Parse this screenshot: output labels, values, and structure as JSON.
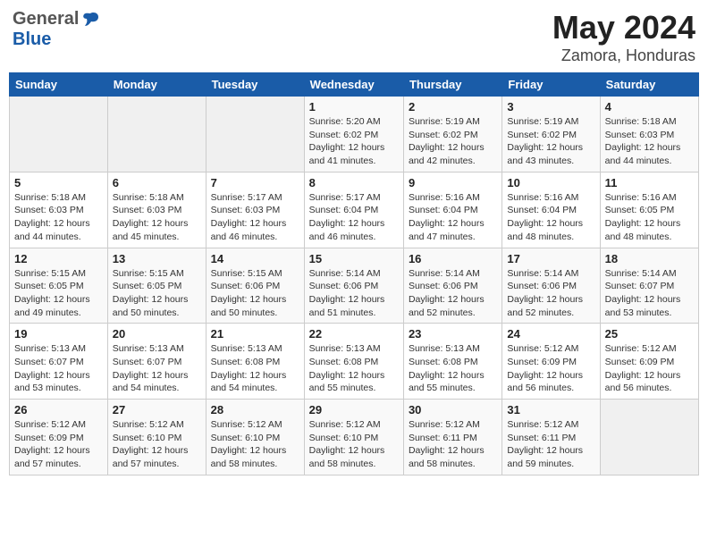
{
  "header": {
    "logo_general": "General",
    "logo_blue": "Blue",
    "month": "May 2024",
    "location": "Zamora, Honduras"
  },
  "days_of_week": [
    "Sunday",
    "Monday",
    "Tuesday",
    "Wednesday",
    "Thursday",
    "Friday",
    "Saturday"
  ],
  "weeks": [
    [
      {
        "day": "",
        "info": ""
      },
      {
        "day": "",
        "info": ""
      },
      {
        "day": "",
        "info": ""
      },
      {
        "day": "1",
        "info": "Sunrise: 5:20 AM\nSunset: 6:02 PM\nDaylight: 12 hours\nand 41 minutes."
      },
      {
        "day": "2",
        "info": "Sunrise: 5:19 AM\nSunset: 6:02 PM\nDaylight: 12 hours\nand 42 minutes."
      },
      {
        "day": "3",
        "info": "Sunrise: 5:19 AM\nSunset: 6:02 PM\nDaylight: 12 hours\nand 43 minutes."
      },
      {
        "day": "4",
        "info": "Sunrise: 5:18 AM\nSunset: 6:03 PM\nDaylight: 12 hours\nand 44 minutes."
      }
    ],
    [
      {
        "day": "5",
        "info": "Sunrise: 5:18 AM\nSunset: 6:03 PM\nDaylight: 12 hours\nand 44 minutes."
      },
      {
        "day": "6",
        "info": "Sunrise: 5:18 AM\nSunset: 6:03 PM\nDaylight: 12 hours\nand 45 minutes."
      },
      {
        "day": "7",
        "info": "Sunrise: 5:17 AM\nSunset: 6:03 PM\nDaylight: 12 hours\nand 46 minutes."
      },
      {
        "day": "8",
        "info": "Sunrise: 5:17 AM\nSunset: 6:04 PM\nDaylight: 12 hours\nand 46 minutes."
      },
      {
        "day": "9",
        "info": "Sunrise: 5:16 AM\nSunset: 6:04 PM\nDaylight: 12 hours\nand 47 minutes."
      },
      {
        "day": "10",
        "info": "Sunrise: 5:16 AM\nSunset: 6:04 PM\nDaylight: 12 hours\nand 48 minutes."
      },
      {
        "day": "11",
        "info": "Sunrise: 5:16 AM\nSunset: 6:05 PM\nDaylight: 12 hours\nand 48 minutes."
      }
    ],
    [
      {
        "day": "12",
        "info": "Sunrise: 5:15 AM\nSunset: 6:05 PM\nDaylight: 12 hours\nand 49 minutes."
      },
      {
        "day": "13",
        "info": "Sunrise: 5:15 AM\nSunset: 6:05 PM\nDaylight: 12 hours\nand 50 minutes."
      },
      {
        "day": "14",
        "info": "Sunrise: 5:15 AM\nSunset: 6:06 PM\nDaylight: 12 hours\nand 50 minutes."
      },
      {
        "day": "15",
        "info": "Sunrise: 5:14 AM\nSunset: 6:06 PM\nDaylight: 12 hours\nand 51 minutes."
      },
      {
        "day": "16",
        "info": "Sunrise: 5:14 AM\nSunset: 6:06 PM\nDaylight: 12 hours\nand 52 minutes."
      },
      {
        "day": "17",
        "info": "Sunrise: 5:14 AM\nSunset: 6:06 PM\nDaylight: 12 hours\nand 52 minutes."
      },
      {
        "day": "18",
        "info": "Sunrise: 5:14 AM\nSunset: 6:07 PM\nDaylight: 12 hours\nand 53 minutes."
      }
    ],
    [
      {
        "day": "19",
        "info": "Sunrise: 5:13 AM\nSunset: 6:07 PM\nDaylight: 12 hours\nand 53 minutes."
      },
      {
        "day": "20",
        "info": "Sunrise: 5:13 AM\nSunset: 6:07 PM\nDaylight: 12 hours\nand 54 minutes."
      },
      {
        "day": "21",
        "info": "Sunrise: 5:13 AM\nSunset: 6:08 PM\nDaylight: 12 hours\nand 54 minutes."
      },
      {
        "day": "22",
        "info": "Sunrise: 5:13 AM\nSunset: 6:08 PM\nDaylight: 12 hours\nand 55 minutes."
      },
      {
        "day": "23",
        "info": "Sunrise: 5:13 AM\nSunset: 6:08 PM\nDaylight: 12 hours\nand 55 minutes."
      },
      {
        "day": "24",
        "info": "Sunrise: 5:12 AM\nSunset: 6:09 PM\nDaylight: 12 hours\nand 56 minutes."
      },
      {
        "day": "25",
        "info": "Sunrise: 5:12 AM\nSunset: 6:09 PM\nDaylight: 12 hours\nand 56 minutes."
      }
    ],
    [
      {
        "day": "26",
        "info": "Sunrise: 5:12 AM\nSunset: 6:09 PM\nDaylight: 12 hours\nand 57 minutes."
      },
      {
        "day": "27",
        "info": "Sunrise: 5:12 AM\nSunset: 6:10 PM\nDaylight: 12 hours\nand 57 minutes."
      },
      {
        "day": "28",
        "info": "Sunrise: 5:12 AM\nSunset: 6:10 PM\nDaylight: 12 hours\nand 58 minutes."
      },
      {
        "day": "29",
        "info": "Sunrise: 5:12 AM\nSunset: 6:10 PM\nDaylight: 12 hours\nand 58 minutes."
      },
      {
        "day": "30",
        "info": "Sunrise: 5:12 AM\nSunset: 6:11 PM\nDaylight: 12 hours\nand 58 minutes."
      },
      {
        "day": "31",
        "info": "Sunrise: 5:12 AM\nSunset: 6:11 PM\nDaylight: 12 hours\nand 59 minutes."
      },
      {
        "day": "",
        "info": ""
      }
    ]
  ]
}
